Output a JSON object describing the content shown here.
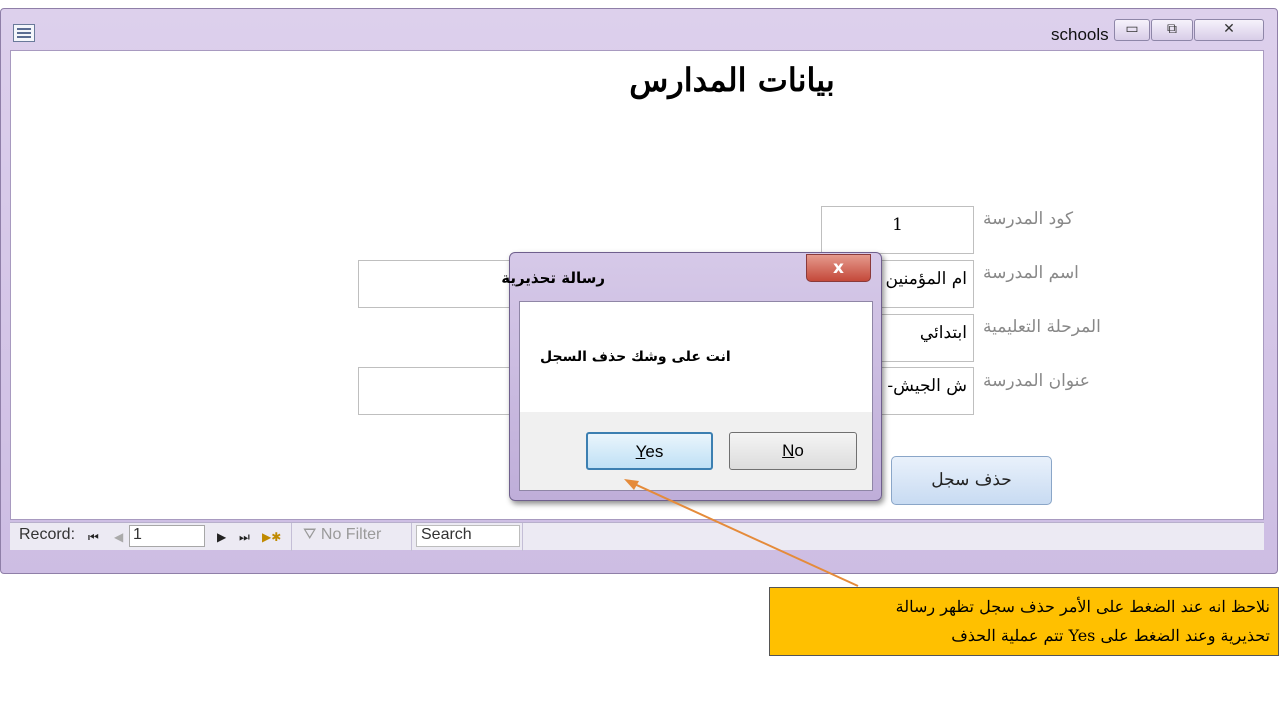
{
  "window": {
    "title": "schools",
    "minimize_glyph": "▭",
    "restore_glyph": "⧉",
    "close_glyph": "✕"
  },
  "form": {
    "title": "بيانات المدارس",
    "fields": [
      {
        "label": "كود المدرسة",
        "value": "1"
      },
      {
        "label": "اسم المدرسة",
        "value": "ام المؤمنين ب"
      },
      {
        "label": "المرحلة التعليمية",
        "value": "ابتدائي"
      },
      {
        "label": "عنوان المدرسة",
        "value": "ش الجيش- ح"
      }
    ],
    "delete_button": "حذف سجل"
  },
  "navbar": {
    "record_label": "Record:",
    "record_value": "1",
    "filter_label": "No Filter",
    "search_value": "Search"
  },
  "dialog": {
    "title": "رسالة تحذيرية",
    "close_glyph": "x",
    "message": "انت على وشك حذف السجل",
    "yes_key": "Y",
    "yes_rest": "es",
    "no_key": "N",
    "no_rest": "o"
  },
  "annotation": {
    "line1": "نلاحظ انه عند الضغط على الأمر حذف سجل تظهر رسالة",
    "line2": "تحذيرية وعند الضغط على Yes تتم عملية الحذف",
    "color": "#ffc000"
  }
}
